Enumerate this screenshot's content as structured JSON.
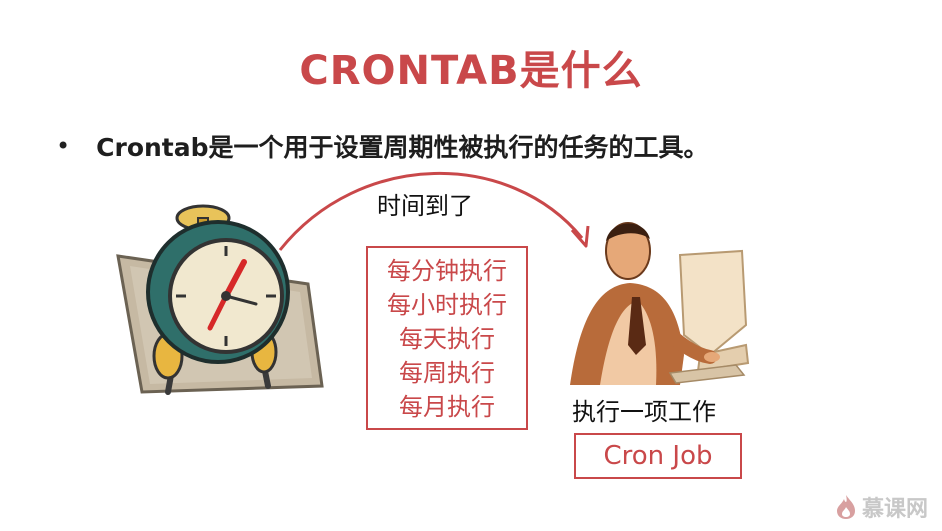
{
  "slide": {
    "title": "CRONTAB是什么",
    "bullet": "Crontab是一个用于设置周期性被执行的任务的工具。",
    "arrow_label": "时间到了",
    "frequencies": [
      "每分钟执行",
      "每小时执行",
      "每天执行",
      "每周执行",
      "每月执行"
    ],
    "task_label": "执行一项工作",
    "cron_job": "Cron Job"
  },
  "watermark": {
    "text": "慕课网",
    "icon": "flame-logo-icon"
  },
  "colors": {
    "accent": "#c9484a",
    "text": "#1e1e1e",
    "watermark": "#c8c8c8"
  }
}
